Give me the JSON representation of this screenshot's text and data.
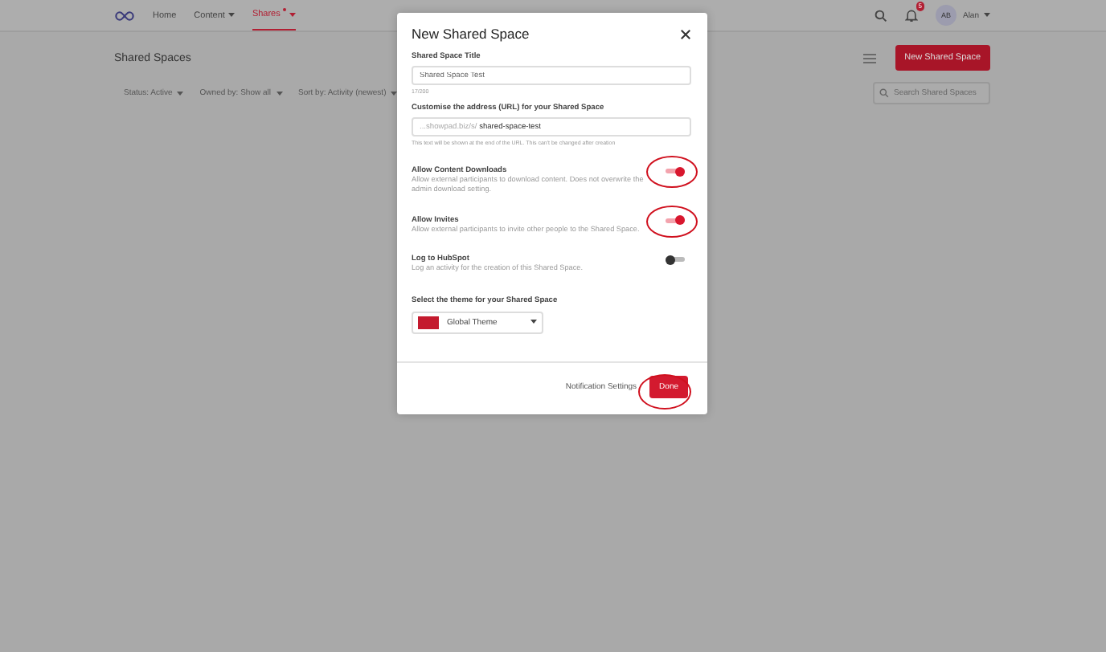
{
  "nav": {
    "items": [
      {
        "label": "Home",
        "selected": false,
        "dropdown": false,
        "dot": false
      },
      {
        "label": "Content",
        "selected": false,
        "dropdown": true,
        "dot": false
      },
      {
        "label": "Shares",
        "selected": true,
        "dropdown": true,
        "dot": true
      }
    ],
    "notifications": "5",
    "avatar": "AB",
    "user": "Alan"
  },
  "page": {
    "title": "Shared Spaces",
    "new_button": "New Shared Space",
    "search": {
      "placeholder": "Search Shared Spaces"
    },
    "filters": [
      "Status: Active",
      "Owned by: Show all",
      "Sort by: Activity (newest)"
    ]
  },
  "dialog": {
    "title": "New Shared Space",
    "title_field": {
      "label": "Shared Space Title",
      "value": "Shared Space Test",
      "counter": "17/200"
    },
    "url_field": {
      "label": "Customise the address (URL) for your Shared Space",
      "prefix": "...showpad.biz/s/",
      "value": "shared-space-test",
      "hint": "This text will be shown at the end of the URL. This can't be changed after creation"
    },
    "toggles": [
      {
        "label": "Allow Content Downloads",
        "description": "Allow external participants to download content. Does not overwrite the admin download setting.",
        "on": true,
        "highlighted": true
      },
      {
        "label": "Allow Invites",
        "description": "Allow external participants to invite other people to the Shared Space.",
        "on": true,
        "highlighted": true
      },
      {
        "label": "Log to HubSpot",
        "description": "Log an activity for the creation of this Shared Space.",
        "on": false,
        "highlighted": false
      }
    ],
    "theme": {
      "label": "Select the theme for your Shared Space",
      "value": "Global Theme"
    },
    "footer": {
      "link": "Notification Settings",
      "done": "Done",
      "done_highlighted": true
    }
  }
}
